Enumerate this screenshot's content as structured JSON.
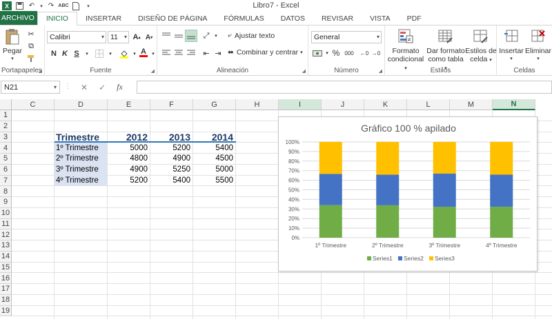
{
  "window": {
    "title": "Libro7 - Excel",
    "app_logo": "X"
  },
  "quick_access": [
    "save-icon",
    "undo-icon",
    "redo-icon",
    "spellcheck-icon",
    "new-doc-icon",
    "customize-icon"
  ],
  "tabs": [
    "ARCHIVO",
    "INICIO",
    "INSERTAR",
    "DISEÑO DE PÁGINA",
    "FÓRMULAS",
    "DATOS",
    "REVISAR",
    "VISTA",
    "PDF"
  ],
  "ribbon": {
    "clipboard": {
      "label": "Portapapeles",
      "paste": "Pegar"
    },
    "font": {
      "label": "Fuente",
      "name": "Calibri",
      "size": "11",
      "bold": "N",
      "italic": "K",
      "underline": "S"
    },
    "alignment": {
      "label": "Alineación",
      "wrap": "Ajustar texto",
      "merge": "Combinar y centrar"
    },
    "number": {
      "label": "Número",
      "format": "General",
      "percent": "%",
      "thousands": "000"
    },
    "styles": {
      "label": "Estilos",
      "conditional": [
        "Formato",
        "condicional"
      ],
      "as_table": [
        "Dar formato",
        "como tabla"
      ],
      "cell_styles": [
        "Estilos de",
        "celda"
      ]
    },
    "cells": {
      "label": "Celdas",
      "insert": "Insertar",
      "delete": "Eliminar"
    }
  },
  "formula_bar": {
    "name_box": "N21",
    "fx": "fx",
    "formula": ""
  },
  "sheet": {
    "columns": [
      "C",
      "D",
      "E",
      "F",
      "G",
      "H",
      "I",
      "J",
      "K",
      "L",
      "M",
      "N"
    ],
    "selected_column": "N",
    "highlighted_column": "I",
    "rows": [
      "1",
      "2",
      "3",
      "4",
      "5",
      "6",
      "7",
      "8",
      "9",
      "10",
      "11",
      "12",
      "13",
      "14",
      "15",
      "16",
      "17",
      "18",
      "19"
    ],
    "table": {
      "headers": [
        "Trimestre",
        "2012",
        "2013",
        "2014"
      ],
      "rows": [
        [
          "1º Trimestre",
          "5000",
          "5200",
          "5400"
        ],
        [
          "2º Trimestre",
          "4800",
          "4900",
          "4500"
        ],
        [
          "3º Trimestre",
          "4900",
          "5250",
          "5000"
        ],
        [
          "4º Trimestre",
          "5200",
          "5400",
          "5500"
        ]
      ]
    }
  },
  "chart_data": {
    "type": "bar",
    "stacked": "percent",
    "title": "Gráfico 100 % apilado",
    "categories": [
      "1º Trimestre",
      "2º Trimestre",
      "3º Trimestre",
      "4º Trimestre"
    ],
    "series": [
      {
        "name": "Series1",
        "values": [
          5000,
          5200,
          5400
        ],
        "color": "#70ad47"
      },
      {
        "name": "Series2",
        "values": [
          4800,
          4900,
          4500
        ],
        "color": "#4472c4"
      },
      {
        "name": "Series3",
        "values": [
          4900,
          5250,
          5000
        ],
        "color": "#ffc000"
      }
    ],
    "stack_values": [
      [
        5000,
        4800,
        4900
      ],
      [
        5200,
        4900,
        5250
      ],
      [
        4900,
        5250,
        5000
      ],
      [
        5200,
        5400,
        5500
      ]
    ],
    "y_ticks": [
      "0%",
      "10%",
      "20%",
      "30%",
      "40%",
      "50%",
      "60%",
      "70%",
      "80%",
      "90%",
      "100%"
    ],
    "ylim": [
      0,
      100
    ],
    "grid": true,
    "legend": "bottom"
  }
}
